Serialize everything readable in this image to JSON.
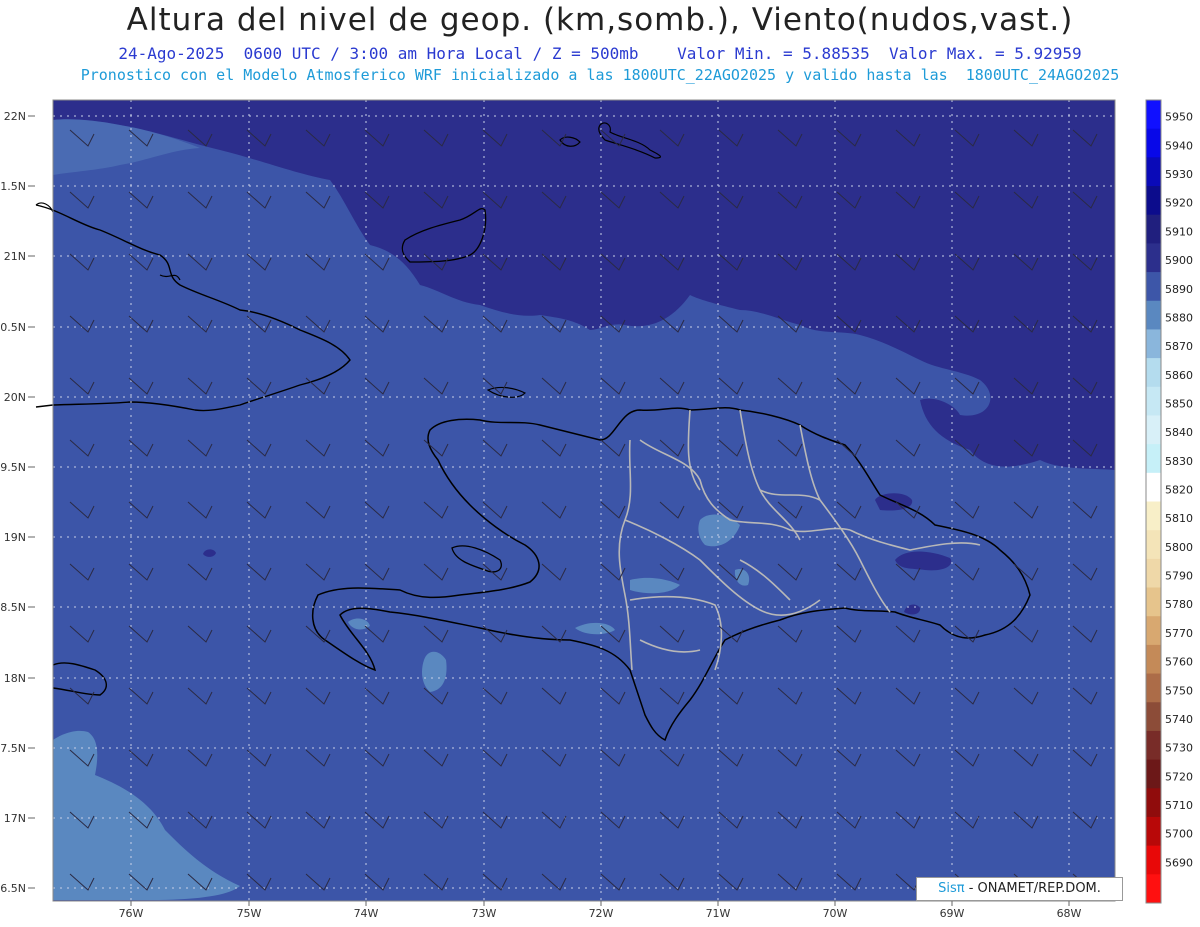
{
  "header": {
    "title": "Altura del nivel de geop. (km,somb.), Viento(nudos,vast.)",
    "line1": "24-Ago-2025  0600 UTC / 3:00 am Hora Local / Z = 500mb    Valor Min. = 5.88535  Valor Max. = 5.92959",
    "line2": "Pronostico con el Modelo Atmosferico WRF inicializado a las 1800UTC_22AGO2025 y valido hasta las  1800UTC_24AGO2025"
  },
  "axes": {
    "lat_labels": [
      "22N",
      "1.5N",
      "21N",
      "0.5N",
      "20N",
      "9.5N",
      "19N",
      "8.5N",
      "18N",
      "7.5N",
      "17N",
      "6.5N"
    ],
    "lon_labels": [
      "76W",
      "75W",
      "74W",
      "73W",
      "72W",
      "71W",
      "70W",
      "69W",
      "68W"
    ]
  },
  "colorbar": {
    "levels": [
      "5950",
      "5940",
      "5930",
      "5920",
      "5910",
      "5900",
      "5890",
      "5880",
      "5870",
      "5860",
      "5850",
      "5840",
      "5830",
      "5820",
      "5810",
      "5800",
      "5790",
      "5780",
      "5770",
      "5760",
      "5750",
      "5740",
      "5730",
      "5720",
      "5710",
      "5700",
      "5690"
    ],
    "colors": [
      "#1010ff",
      "#0808e8",
      "#0a0ab8",
      "#0c0c8c",
      "#201f7e",
      "#2c2f8c",
      "#3d56a8",
      "#5a88c0",
      "#8ab6dc",
      "#b4dcee",
      "#c6e8f4",
      "#d8f0f8",
      "#c6f0f8",
      "#ffffff",
      "#f8efc8",
      "#f4e4b8",
      "#efd8a8",
      "#e6c48c",
      "#d8a870",
      "#c48a58",
      "#ac6c48",
      "#8c4c38",
      "#782c28",
      "#6c1818",
      "#900c0c",
      "#b80808",
      "#e80808",
      "#ff1010"
    ]
  },
  "map": {
    "colors": {
      "ocean_fill": "#3c55a8",
      "north_fill": "#2c2e8c",
      "light_fill": "#5a88c0",
      "coast": "#000000",
      "border": "#b8b8b8"
    }
  },
  "credit": {
    "brand": "Sisπ",
    "text": "- ONAMET/REP.DOM."
  }
}
